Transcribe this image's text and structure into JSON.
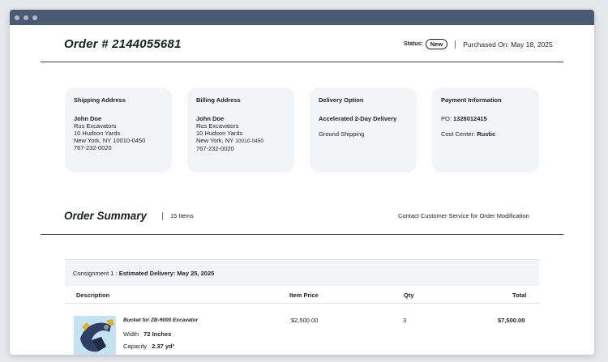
{
  "order": {
    "title": "Order # 2144055681",
    "status_label": "Status:",
    "status": "New",
    "purchased_on": "Purchased On: May 18, 2025"
  },
  "cards": {
    "shipping": {
      "title": "Shipping Address",
      "name": "John Doe",
      "company": "Rus Excavators",
      "street": "10 Hudson Yards",
      "city": "New York, NY 10010-0450",
      "phone": "767-232-0020"
    },
    "billing": {
      "title": "Billing Address",
      "name": "John Doe",
      "company": "Rus Excavators",
      "street": "10 Hudson Yards",
      "city_main": "New York, NY",
      "zip": "10010-0450",
      "phone": "767-232-0020"
    },
    "delivery": {
      "title": "Delivery Option",
      "option": "Accelerated 2-Day Delivery",
      "method": "Ground Shipping"
    },
    "payment": {
      "title": "Payment Information",
      "po_label": "PO:",
      "po_value": "1328012415",
      "cost_center_label": "Cost Center:",
      "cost_center_value": "Rustic"
    }
  },
  "summary": {
    "title": "Order Summary",
    "items_count": "15 Items",
    "contact": "Contact Customer Service for Order Modification"
  },
  "consignment": {
    "label": "Consignment 1 :",
    "delivery": "Estimated Delivery: May 25, 2025"
  },
  "table": {
    "headers": {
      "description": "Description",
      "price": "Item Price",
      "qty": "Qty",
      "total": "Total"
    },
    "rows": [
      {
        "name": "Bucket for ZB-9000 Excavator",
        "width_label": "Width",
        "width_value": "72 Inches",
        "capacity_label": "Capacity",
        "capacity_value": "2.37 yd³",
        "price": "$2,500.00",
        "qty": "3",
        "total": "$7,500.00"
      }
    ]
  }
}
